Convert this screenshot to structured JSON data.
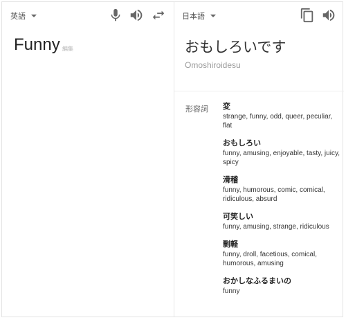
{
  "source": {
    "language": "英語",
    "text": "Funny",
    "edit_label": "編集"
  },
  "target": {
    "language": "日本語",
    "text": "おもしろいです",
    "romanization": "Omoshiroidesu"
  },
  "dictionary": {
    "pos_label": "形容詞",
    "entries": [
      {
        "word": "変",
        "synonyms": "strange, funny, odd, queer, peculiar, flat"
      },
      {
        "word": "おもしろい",
        "synonyms": "funny, amusing, enjoyable, tasty, juicy, spicy"
      },
      {
        "word": "滑稽",
        "synonyms": "funny, humorous, comic, comical, ridiculous, absurd"
      },
      {
        "word": "可笑しい",
        "synonyms": "funny, amusing, strange, ridiculous"
      },
      {
        "word": "剽軽",
        "synonyms": "funny, droll, facetious, comical, humorous, amusing"
      },
      {
        "word": "おかしなふるまいの",
        "synonyms": "funny"
      }
    ]
  },
  "icons": {
    "mic": "microphone-icon",
    "speaker_source": "speaker-icon",
    "swap": "swap-arrows-icon",
    "copy": "copy-icon",
    "speaker_target": "speaker-icon"
  },
  "colors": {
    "icon": "#666666",
    "border": "#e3e3e3",
    "muted_text": "#999999"
  }
}
